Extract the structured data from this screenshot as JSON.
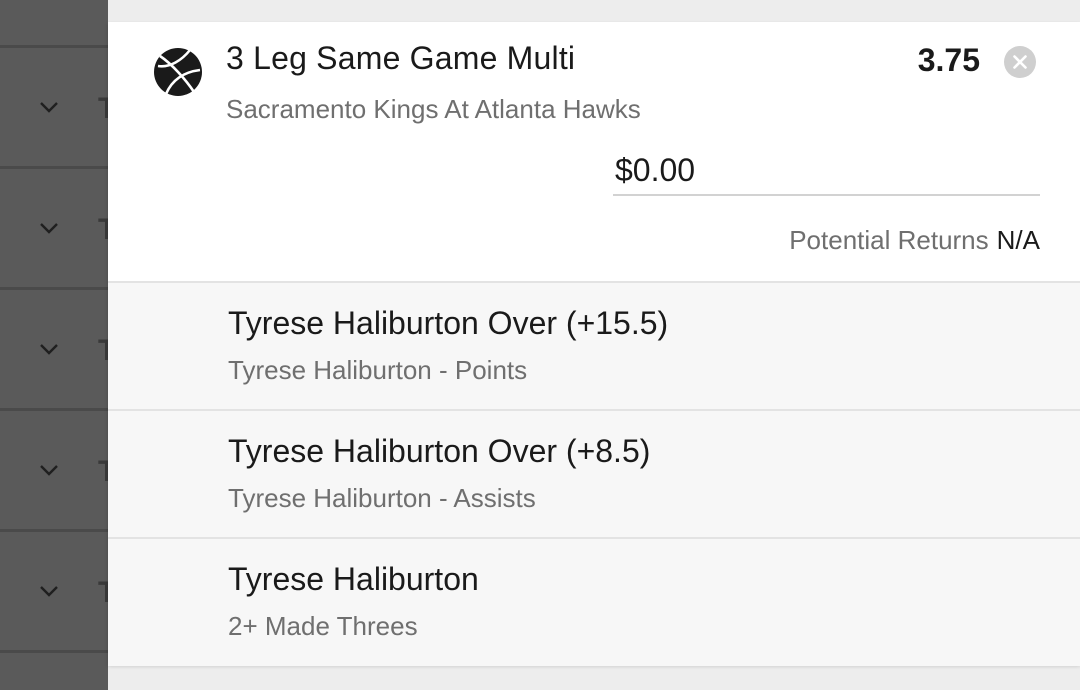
{
  "left_panel": {
    "rows": 6
  },
  "bet": {
    "sport_icon": "basketball-icon",
    "title": "3 Leg Same Game Multi",
    "match": "Sacramento Kings At Atlanta Hawks",
    "odds": "3.75",
    "close_icon": "close-icon",
    "stake_value": "$0.00",
    "potential_returns_label": "Potential Returns",
    "potential_returns_value": "N/A"
  },
  "legs": [
    {
      "title": "Tyrese Haliburton Over (+15.5)",
      "subtitle": "Tyrese Haliburton - Points"
    },
    {
      "title": "Tyrese Haliburton Over (+8.5)",
      "subtitle": "Tyrese Haliburton - Assists"
    },
    {
      "title": "Tyrese Haliburton",
      "subtitle": "2+ Made Threes"
    }
  ],
  "colors": {
    "card_bg": "#ffffff",
    "legs_bg": "#f7f7f7",
    "overlay_panel": "#5a5a5a",
    "text_primary": "#1a1a1a",
    "text_secondary": "#6f6f6f"
  }
}
